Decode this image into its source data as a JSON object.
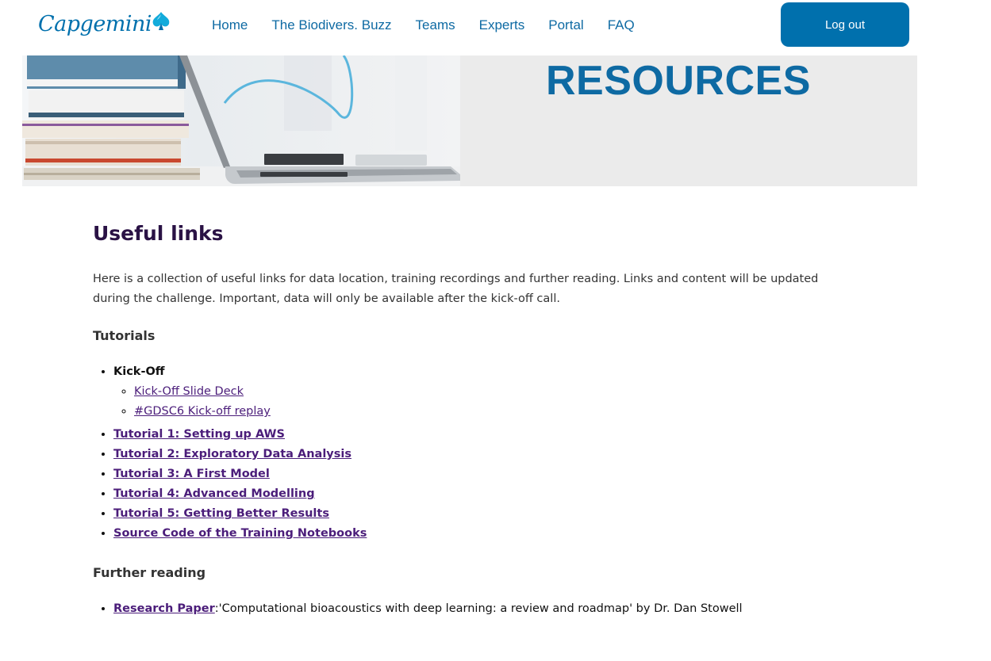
{
  "header": {
    "logo_text": "Capgemini",
    "nav": [
      {
        "label": "Home"
      },
      {
        "label": "The Biodivers. Buzz"
      },
      {
        "label": "Teams"
      },
      {
        "label": "Experts"
      },
      {
        "label": "Portal"
      },
      {
        "label": "FAQ"
      }
    ],
    "logout_label": "Log out"
  },
  "banner": {
    "title": "RESOURCES"
  },
  "main": {
    "title": "Useful links",
    "intro": "Here is a collection of useful links for data location, training recordings and further reading. Links and content will be updated during the challenge. Important, data will only be available after the kick-off call.",
    "tutorials": {
      "heading": "Tutorials",
      "kickoff": {
        "label": "Kick-Off",
        "links": [
          "Kick-Off Slide Deck",
          "#GDSC6 Kick-off replay"
        ]
      },
      "items": [
        "Tutorial 1: Setting up AWS",
        "Tutorial 2: Exploratory Data Analysis",
        "Tutorial 3: A First Model",
        "Tutorial 4: Advanced Modelling",
        "Tutorial 5: Getting Better Results",
        "Source Code of the Training Notebooks"
      ]
    },
    "further_reading": {
      "heading": "Further reading",
      "link": "Research Paper",
      "description": ":'Computational bioacoustics with deep learning: a review and roadmap' by Dr. Dan Stowell"
    }
  },
  "colors": {
    "brand_blue": "#0070ad",
    "heading_purple": "#2a1245",
    "link_purple": "#4b1d7a",
    "banner_grey": "#ebebeb"
  }
}
